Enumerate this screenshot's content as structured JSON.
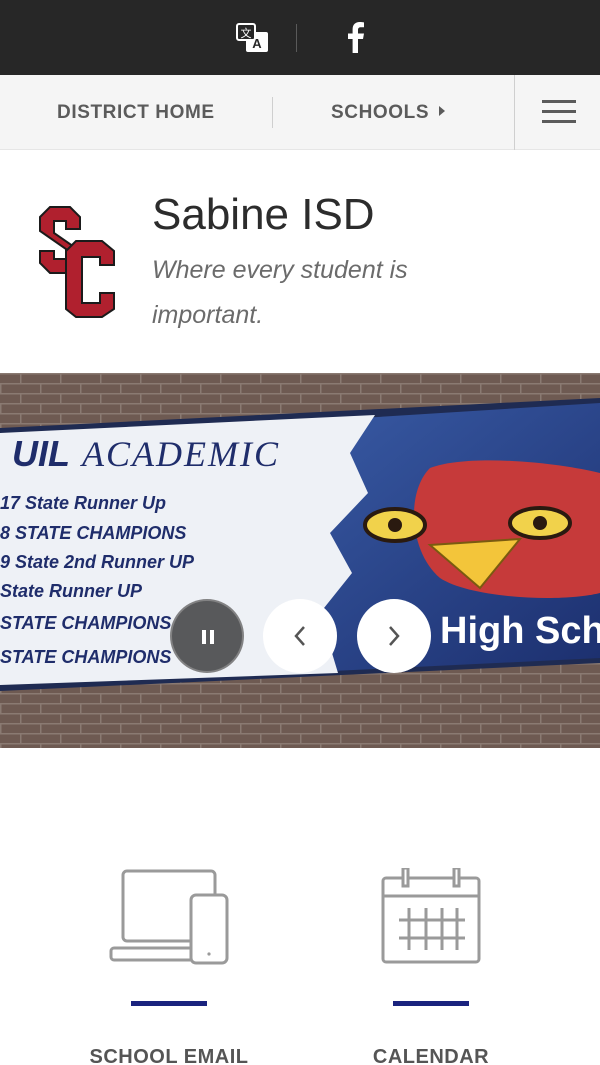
{
  "topbar": {
    "translate_icon": "translate-icon",
    "facebook_icon": "facebook-icon",
    "background": "#272727"
  },
  "nav": {
    "district_home": "DISTRICT HOME",
    "schools": "SCHOOLS",
    "menu_icon": "hamburger-menu-icon"
  },
  "header": {
    "title": "Sabine ISD",
    "tagline": "Where every student is important.",
    "logo_color": "#b0202e"
  },
  "hero": {
    "banner_title": "UIL ACADEMIC",
    "banner_lines": [
      "17  State Runner Up",
      "8 STATE CHAMPIONS",
      "9 State 2nd Runner UP",
      " State Runner UP",
      " STATE CHAMPIONS",
      "STATE CHAMPIONS"
    ],
    "banner_school_text": "High Sch",
    "controls": {
      "pause_icon": "pause-icon",
      "prev_icon": "chevron-left-icon",
      "next_icon": "chevron-right-icon"
    }
  },
  "quicklinks": [
    {
      "label": "SCHOOL EMAIL",
      "icon": "devices-icon"
    },
    {
      "label": "CALENDAR",
      "icon": "calendar-icon"
    }
  ],
  "colors": {
    "accent_bar": "#1a237e",
    "nav_text": "#5b5b5b"
  }
}
